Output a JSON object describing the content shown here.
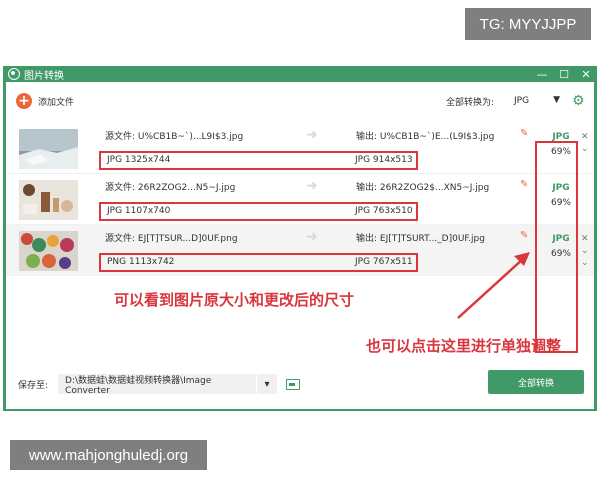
{
  "overlay": {
    "tg_badge": "TG: MYYJJPP",
    "watermark": "www.mahjonghuledj.org"
  },
  "window": {
    "title": "图片转换",
    "controls": [
      "—",
      "☐",
      "✕"
    ]
  },
  "toolbar": {
    "add_label": "添加文件",
    "convert_all_label": "全部转换为:",
    "format_value": "JPG",
    "gear_icon": "gear-icon"
  },
  "rows": [
    {
      "src_name": "源文件:  U%CB1B~`)...L9I$3.jpg",
      "out_name": "输出:  U%CB1B~`)E...(L9I$3.jpg",
      "src_info": "JPG  1325x744",
      "out_info": "JPG  914x513",
      "fmt": "JPG",
      "quality": "69%"
    },
    {
      "src_name": "源文件:  26R2ZOG2...N5~J.jpg",
      "out_name": "输出:  26R2ZOG2$...XN5~J.jpg",
      "src_info": "JPG  1107x740",
      "out_info": "JPG  763x510",
      "fmt": "JPG",
      "quality": "69%"
    },
    {
      "src_name": "源文件:  EJ[T]TSUR...D]0UF.png",
      "out_name": "输出:  EJ[T]TSURT..._D]0UF.jpg",
      "src_info": "PNG  1113x742",
      "out_info": "JPG  767x511",
      "fmt": "JPG",
      "quality": "69%"
    }
  ],
  "annotations": {
    "size_note": "可以看到图片原大小和更改后的尺寸",
    "adjust_note": "也可以点击这里进行单独调整",
    "color": "#d9363e"
  },
  "footer": {
    "save_label": "保存至:",
    "path": "D:\\数据蛙\\数据蛙视频转换器\\Image Converter",
    "convert_btn": "全部转换"
  },
  "colors": {
    "brand_green": "#3f9a67",
    "accent_orange": "#e8683c",
    "highlight_red": "#d9363e"
  }
}
